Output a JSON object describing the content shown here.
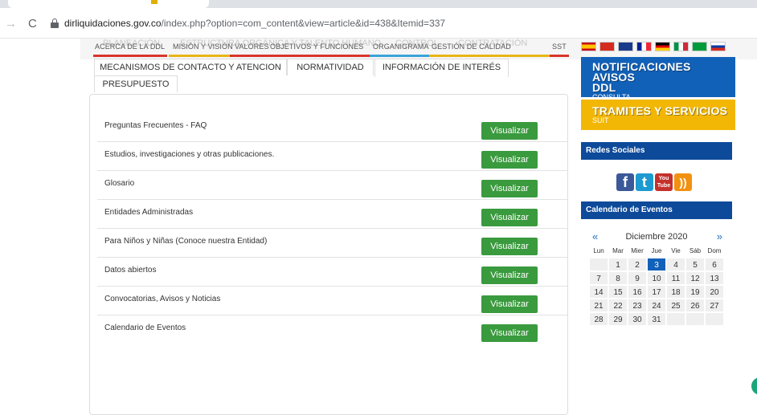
{
  "browser": {
    "url_host": "dirliquidaciones.gov.co",
    "url_path": "/index.php?option=com_content&view=article&id=438&Itemid=337"
  },
  "topmenu": {
    "ghost_items": [
      "PLANEACIÓN",
      "ESTRUCTURA ORGÁNICA Y TALENTO HUMANO",
      "CONTROL",
      "CONTRATACIÓN"
    ],
    "items": [
      "ACERCA DE LA DDL",
      "MISIÓN Y VISIÓN",
      "VALORES",
      "OBJETIVOS Y FUNCIONES",
      "ORGANIGRAMA",
      "GESTIÓN DE CALIDAD",
      "SST"
    ]
  },
  "tabs": [
    {
      "label": "MECANISMOS DE CONTACTO Y ATENCION"
    },
    {
      "label": "NORMATIVIDAD"
    },
    {
      "label": "INFORMACIÓN DE INTERÉS"
    },
    {
      "label": "PRESUPUESTO"
    }
  ],
  "rows": [
    {
      "label": "Preguntas Frecuentes - FAQ",
      "button": "Visualizar"
    },
    {
      "label": "Estudios, investigaciones y otras publicaciones.",
      "button": "Visualizar"
    },
    {
      "label": "Glosario",
      "button": "Visualizar"
    },
    {
      "label": "Entidades Administradas",
      "button": "Visualizar"
    },
    {
      "label": "Para Niños y Niñas (Conoce nuestra Entidad)",
      "button": "Visualizar"
    },
    {
      "label": "Datos abiertos",
      "button": "Visualizar"
    },
    {
      "label": "Convocatorias, Avisos y Noticias",
      "button": "Visualizar"
    },
    {
      "label": "Calendario de Eventos",
      "button": "Visualizar"
    }
  ],
  "sidebar": {
    "notif_title_1": "NOTIFICACIONES AVISOS",
    "notif_title_2": "DDL",
    "notif_sub": "CONSULTA",
    "tramites_title": "TRAMITES Y SERVICIOS",
    "tramites_sub": "SUIT",
    "redes_title": "Redes Sociales",
    "calendario_title": "Calendario de Eventos",
    "social": {
      "fb": "f",
      "tw": "t",
      "yt_1": "You",
      "yt_2": "Tube",
      "rss": "))"
    }
  },
  "calendar": {
    "prev": "«",
    "next": "»",
    "month": "Diciembre 2020",
    "days_of_week": [
      "Lun",
      "Mar",
      "Mier",
      "Jue",
      "Vie",
      "Sáb",
      "Dom"
    ],
    "weeks": [
      [
        "",
        "1",
        "2",
        "3",
        "4",
        "5",
        "6"
      ],
      [
        "7",
        "8",
        "9",
        "10",
        "11",
        "12",
        "13"
      ],
      [
        "14",
        "15",
        "16",
        "17",
        "18",
        "19",
        "20"
      ],
      [
        "21",
        "22",
        "23",
        "24",
        "25",
        "26",
        "27"
      ],
      [
        "28",
        "29",
        "30",
        "31",
        "",
        "",
        ""
      ]
    ],
    "today": "3"
  },
  "colors": {
    "accent_blue": "#0e4a9a",
    "button_green": "#3a9a3e",
    "promo_yellow": "#f2b705",
    "promo_blue": "#1261b8"
  }
}
